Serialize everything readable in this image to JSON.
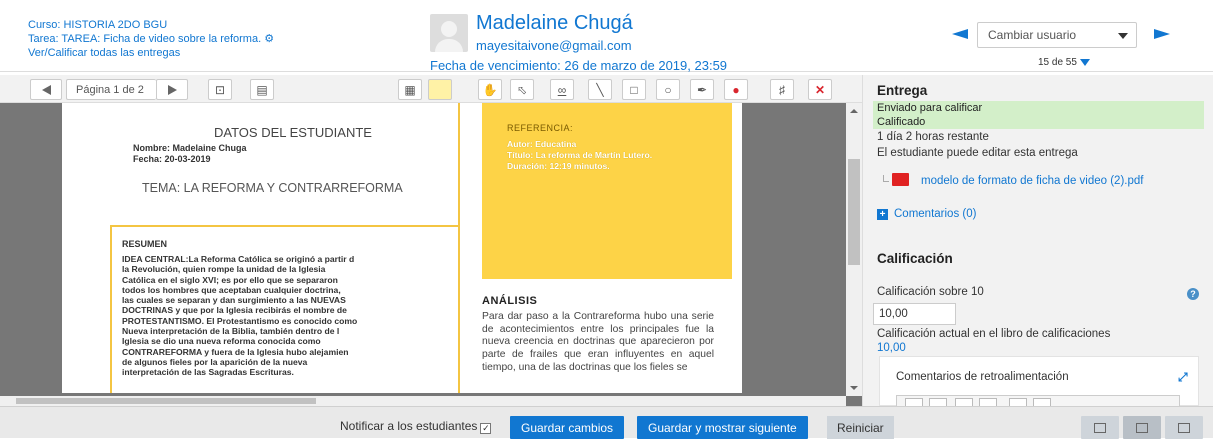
{
  "header": {
    "course": "Curso: HISTORIA 2DO BGU",
    "task": "Tarea: TAREA: Ficha de video sobre la reforma.",
    "grade_all": "Ver/Calificar todas las entregas",
    "user_name": "Madelaine Chugá",
    "user_email": "mayesitaivone@gmail.com",
    "due_date": "Fecha de vencimiento: 26 de marzo de 2019, 23:59",
    "change_user": "Cambiar usuario",
    "count": "15 de 55",
    "accent": "#1177d1"
  },
  "toolbar": {
    "page_label": "Página 1 de 2",
    "icons": [
      "prev-page-icon",
      "next-page-icon",
      "search-icon",
      "comment-list-icon",
      "comment-icon",
      "highlight-color-icon",
      "pan-icon",
      "select-icon",
      "pen-icon",
      "line-icon",
      "rectangle-icon",
      "oval-icon",
      "highlight-icon",
      "color-icon",
      "stamp-icon",
      "delete-icon"
    ]
  },
  "document": {
    "left": {
      "title": "DATOS DEL ESTUDIANTE",
      "name": "Nombre: Madelaine Chuga",
      "date": "Fecha: 20-03-2019",
      "topic": "TEMA: LA REFORMA Y CONTRARREFORMA",
      "summary_title": "RESUMEN",
      "summary_text": "IDEA CENTRAL:La Reforma Católica se originó a partir d\nla Revolución, quien rompe la unidad de la Iglesia\nCatólica en el siglo XVI; es por ello que se separaron\ntodos los hombres que aceptaban cualquier doctrina,\nlas cuales se separan y dan surgimiento a las NUEVAS\nDOCTRINAS y que por la Iglesia recibirás el nombre de\nPROTESTANTISMO. El Protestantismo es conocido como\nNueva interpretación de la Biblia, también dentro de l\nIglesia se dio una nueva reforma conocida como\nCONTRAREFORMA y fuera de la Iglesia hubo alejamien\nde algunos fieles por la aparición de la nueva\ninterpretación de las Sagradas Escrituras."
    },
    "right": {
      "ref_title": "REFERENCIA:",
      "ref_author": "Autor: Educatina",
      "ref_title_line": "Título: La reforma de Martín Lutero.",
      "ref_duration": "Duración: 12:19 minutos.",
      "analysis_title": "ANÁLISIS",
      "analysis_text": "Para dar paso a la Contrareforma hubo una serie de acontecimientos entre los principales fue la nueva creencia en doctrinas que aparecieron por parte de frailes que eran influyentes en aquel tiempo, una de las doctrinas que los fieles se"
    }
  },
  "submission": {
    "heading": "Entrega",
    "status1": "Enviado para calificar",
    "status2": "Calificado",
    "remaining": "1 día 2 horas restante",
    "can_edit": "El estudiante puede editar esta entrega",
    "file": "modelo de formato de ficha de video (2).pdf",
    "comments": "Comentarios (0)",
    "status_color": "#d3efc9"
  },
  "grading": {
    "heading": "Calificación",
    "grade_label": "Calificación sobre 10",
    "grade_value": "10,00",
    "current_label": "Calificación actual en el libro de calificaciones",
    "current_value": "10,00",
    "feedback_label": "Comentarios de retroalimentación"
  },
  "footer": {
    "notify": "Notificar a los estudiantes",
    "notify_checked": true,
    "save": "Guardar cambios",
    "save_next": "Guardar y mostrar siguiente",
    "reset": "Reiniciar"
  }
}
